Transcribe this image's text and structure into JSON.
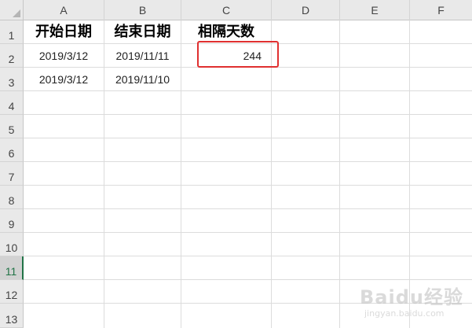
{
  "columns": [
    "A",
    "B",
    "C",
    "D",
    "E",
    "F"
  ],
  "rows": [
    "1",
    "2",
    "3",
    "4",
    "5",
    "6",
    "7",
    "8",
    "9",
    "10",
    "11",
    "12",
    "13"
  ],
  "active_row": "11",
  "cells": {
    "A1": "开始日期",
    "B1": "结束日期",
    "C1": "相隔天数",
    "A2": "2019/3/12",
    "B2": "2019/11/11",
    "C2": "244",
    "A3": "2019/3/12",
    "B3": "2019/11/10"
  },
  "watermark": {
    "brand": "Baidu经验",
    "url": "jingyan.baidu.com"
  },
  "colors": {
    "highlight": "#e03030",
    "active_row_accent": "#217346",
    "header_bg": "#e9e9e9"
  }
}
